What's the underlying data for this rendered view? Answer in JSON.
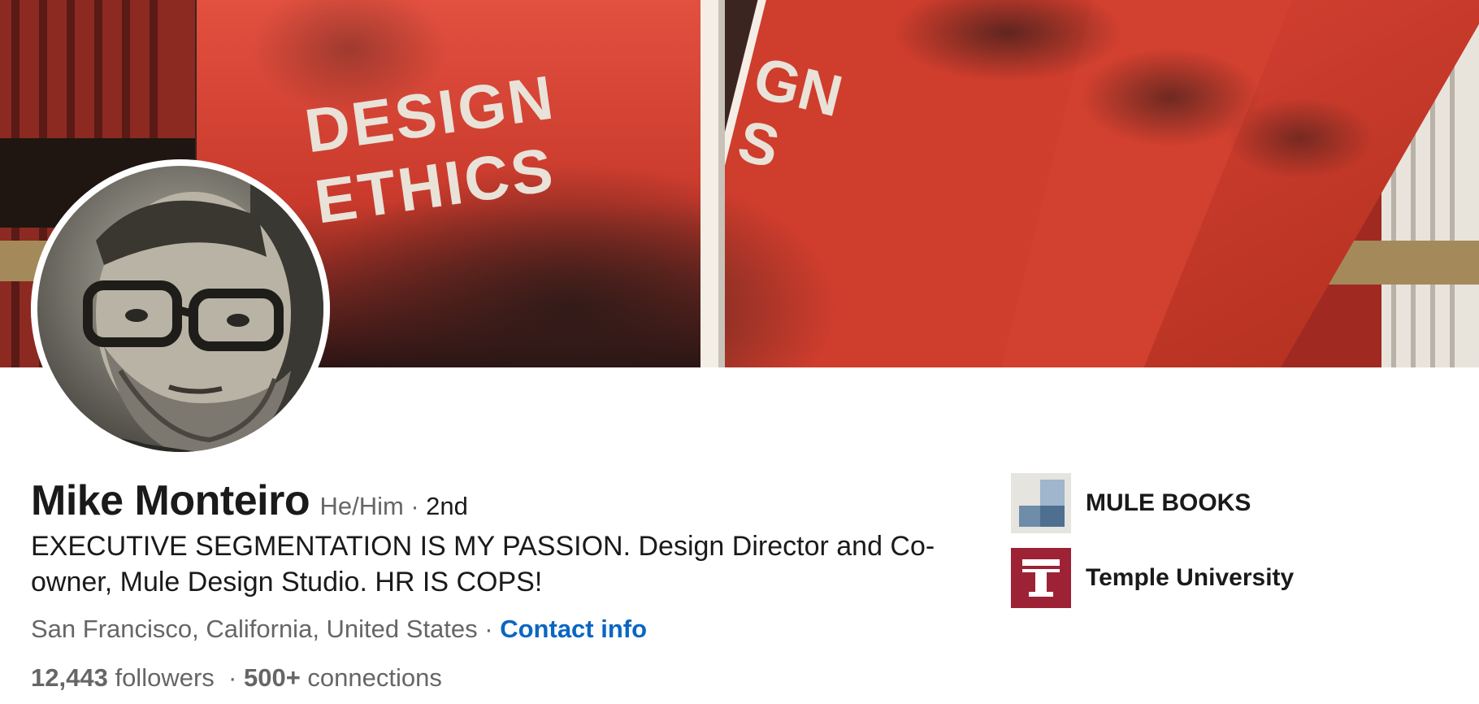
{
  "profile": {
    "name": "Mike Monteiro",
    "pronouns": "He/Him",
    "separator": "·",
    "degree": "2nd",
    "headline": "EXECUTIVE SEGMENTATION IS MY PASSION. Design Director and Co-owner, Mule Design Studio. HR IS COPS!",
    "location": "San Francisco, California, United States",
    "contact_label": "Contact info",
    "followers_count": "12,443",
    "followers_label": "followers",
    "connections_count": "500+",
    "connections_label": "connections"
  },
  "cover": {
    "book_title_line1": "DESIGN",
    "book_title_line2": "ETHICS",
    "book2_fragment_line1": "GN",
    "book2_fragment_line2": "S",
    "accent_color": "#d63a2a"
  },
  "organizations": [
    {
      "name": "MULE BOOKS",
      "logo_icon": "mule-books-logo-icon"
    },
    {
      "name": "Temple University",
      "logo_icon": "temple-university-logo-icon",
      "logo_color": "#9d2235"
    }
  ],
  "colors": {
    "link": "#0a66c2",
    "text_primary": "#1a1a1a",
    "text_secondary": "#666666"
  }
}
